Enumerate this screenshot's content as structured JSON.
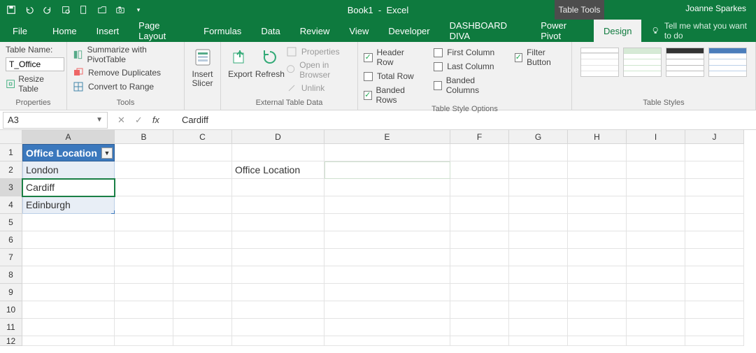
{
  "title": {
    "doc": "Book1",
    "app": "Excel",
    "contextual_tab": "Table Tools",
    "user": "Joanne Sparkes"
  },
  "tabs": [
    "File",
    "Home",
    "Insert",
    "Page Layout",
    "Formulas",
    "Data",
    "Review",
    "View",
    "Developer",
    "DASHBOARD DIVA",
    "Power Pivot",
    "Design"
  ],
  "tell_me": "Tell me what you want to do",
  "ribbon": {
    "properties": {
      "label": "Properties",
      "table_name_label": "Table Name:",
      "table_name_value": "T_Office",
      "resize": "Resize Table"
    },
    "tools": {
      "label": "Tools",
      "summarize": "Summarize with PivotTable",
      "remove_dupes": "Remove Duplicates",
      "convert": "Convert to Range"
    },
    "slicer": {
      "insert_slicer": "Insert\nSlicer"
    },
    "external": {
      "label": "External Table Data",
      "export": "Export",
      "refresh": "Refresh",
      "properties": "Properties",
      "open_browser": "Open in Browser",
      "unlink": "Unlink"
    },
    "style_options": {
      "label": "Table Style Options",
      "header_row": "Header Row",
      "total_row": "Total Row",
      "banded_rows": "Banded Rows",
      "first_col": "First Column",
      "last_col": "Last Column",
      "banded_cols": "Banded Columns",
      "filter_btn": "Filter Button"
    },
    "styles": {
      "label": "Table Styles"
    }
  },
  "formula_bar": {
    "name_box": "A3",
    "value": "Cardiff"
  },
  "columns": [
    "A",
    "B",
    "C",
    "D",
    "E",
    "F",
    "G",
    "H",
    "I",
    "J"
  ],
  "table": {
    "header": "Office Location",
    "rows": [
      "London",
      "Cardiff",
      "Edinburgh"
    ]
  },
  "cells": {
    "D2": "Office Location"
  },
  "chart_data": null
}
